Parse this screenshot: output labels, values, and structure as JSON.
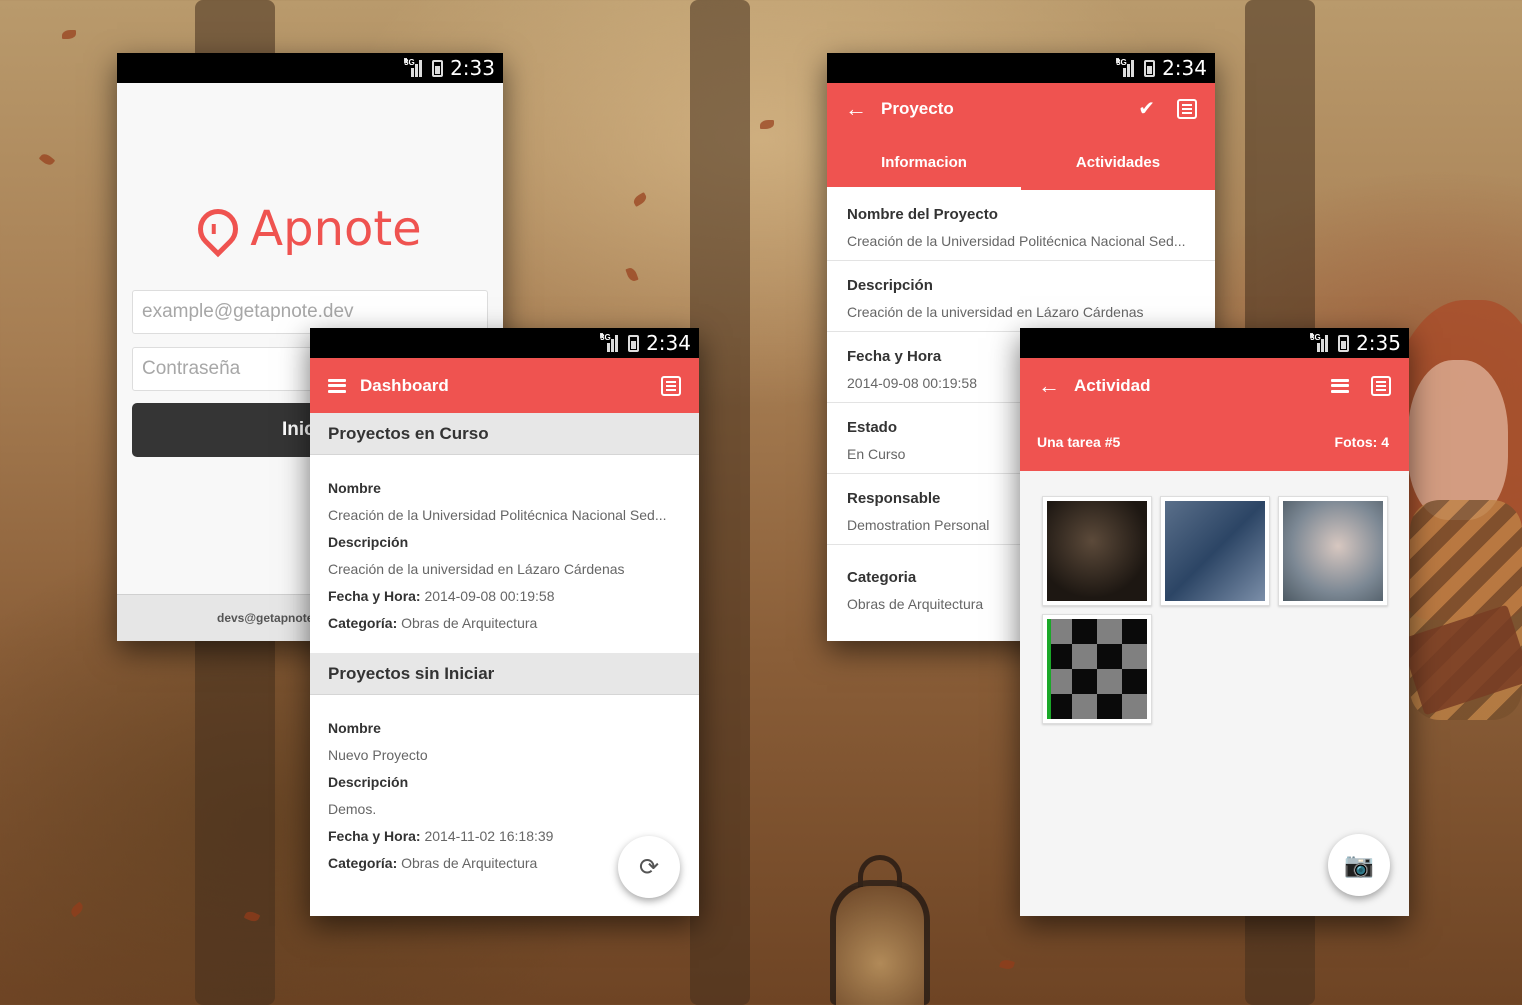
{
  "status_bar": {
    "network": "3G"
  },
  "login": {
    "time": "2:33",
    "logo_text": "Apnote",
    "email_placeholder": "example@getapnote.dev",
    "password_placeholder": "Contraseña",
    "submit_label": "Iniciar",
    "footer_text": "devs@getapnote"
  },
  "dashboard": {
    "time": "2:34",
    "title": "Dashboard",
    "sections": [
      {
        "heading": "Proyectos en Curso",
        "name_label": "Nombre",
        "name_value": "Creación de la Universidad Politécnica Nacional Sed...",
        "desc_label": "Descripción",
        "desc_value": "Creación de la universidad en Lázaro Cárdenas",
        "date_label": "Fecha y Hora:",
        "date_value": "2014-09-08 00:19:58",
        "cat_label": "Categoría:",
        "cat_value": "Obras de Arquitectura"
      },
      {
        "heading": "Proyectos sin Iniciar",
        "name_label": "Nombre",
        "name_value": "Nuevo Proyecto",
        "desc_label": "Descripción",
        "desc_value": "Demos.",
        "date_label": "Fecha y Hora:",
        "date_value": "2014-11-02 16:18:39",
        "cat_label": "Categoría:",
        "cat_value": "Obras de Arquitectura"
      }
    ],
    "fab_icon": "refresh-icon"
  },
  "proyecto": {
    "time": "2:34",
    "title": "Proyecto",
    "tabs": [
      "Informacion",
      "Actividades"
    ],
    "active_tab": 0,
    "fields": [
      {
        "label": "Nombre del Proyecto",
        "value": "Creación de la Universidad Politécnica Nacional Sed..."
      },
      {
        "label": "Descripción",
        "value": "Creación de la universidad en Lázaro Cárdenas"
      },
      {
        "label": "Fecha y Hora",
        "value": "2014-09-08 00:19:58"
      },
      {
        "label": "Estado",
        "value": "En Curso"
      },
      {
        "label": "Responsable",
        "value": "Demostration Personal"
      },
      {
        "label": "Categoria",
        "value": "Obras de Arquitectura"
      }
    ]
  },
  "actividad": {
    "time": "2:35",
    "title": "Actividad",
    "task": "Una tarea #5",
    "photos": "Fotos: 4",
    "fab_icon": "camera-icon"
  },
  "colors": {
    "accent": "#ef5350",
    "login_button": "#353535",
    "section_header": "#e7e7e7"
  }
}
